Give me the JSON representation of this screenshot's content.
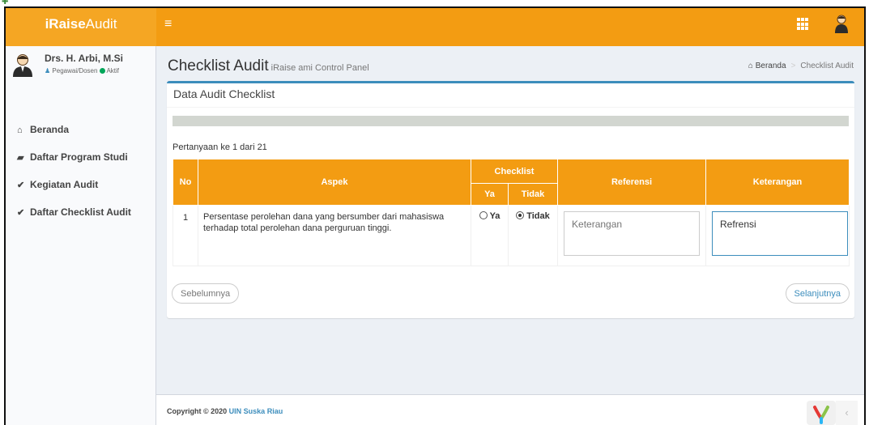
{
  "brand": {
    "bold": "iRaise",
    "light": "Audit"
  },
  "header": {
    "menu_icon": "menu-icon",
    "apps_icon": "apps-grid-icon",
    "user_icon": "user-icon"
  },
  "user": {
    "name": "Drs. H. Arbi, M.Si",
    "role": "Pegawai/Dosen",
    "status": "Aktif"
  },
  "sidebar": {
    "items": [
      {
        "label": "Beranda",
        "icon": "home-icon",
        "glyph": "⌂"
      },
      {
        "label": "Daftar Program Studi",
        "icon": "book-icon",
        "glyph": "▰"
      },
      {
        "label": "Kegiatan Audit",
        "icon": "check-icon",
        "glyph": "✔"
      },
      {
        "label": "Daftar Checklist Audit",
        "icon": "check-icon",
        "glyph": "✔"
      }
    ]
  },
  "page": {
    "title": "Checklist Audit",
    "subtitle": "iRaise ami Control Panel"
  },
  "breadcrumb": {
    "home": "Beranda",
    "current": "Checklist Audit"
  },
  "box": {
    "title": "Data Audit Checklist",
    "progress_percent": 0,
    "counter": "Pertanyaan ke 1 dari 21"
  },
  "table": {
    "headers": {
      "no": "No",
      "aspek": "Aspek",
      "checklist": "Checklist",
      "ya": "Ya",
      "tidak": "Tidak",
      "referensi": "Referensi",
      "keterangan": "Keterangan"
    },
    "rows": [
      {
        "no": "1",
        "aspek": "Persentase perolehan dana yang bersumber dari mahasiswa terhadap total perolehan dana perguruan tinggi.",
        "option_ya": "Ya",
        "option_tidak": "Tidak",
        "selected": "Tidak",
        "referensi_placeholder": "Keterangan",
        "keterangan_value": "Refrensi"
      }
    ]
  },
  "buttons": {
    "prev": "Sebelumnya",
    "next": "Selanjutnya"
  },
  "footer": {
    "copyright": "Copyright © 2020",
    "org": "UIN Suska Riau"
  },
  "colors": {
    "header": "#f39c12",
    "accent": "#3c8dbc",
    "sidebar_bg": "#f9fafc"
  }
}
